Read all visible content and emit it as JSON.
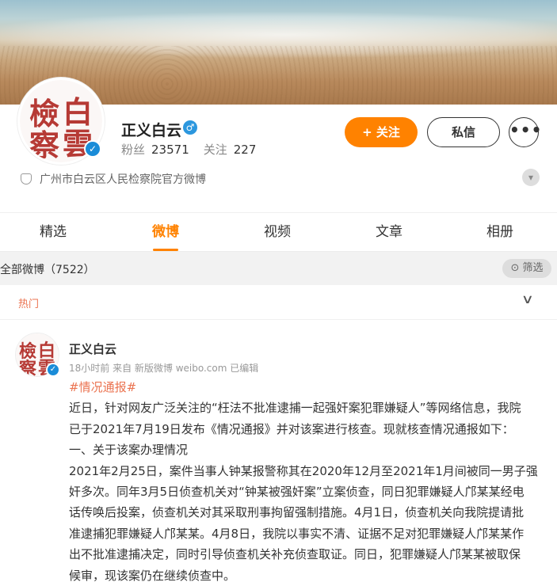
{
  "profile": {
    "name": "正义白云",
    "fans_label": "粉丝",
    "fans_count": "23571",
    "follow_label": "关注",
    "follow_count": "227",
    "description": "广州市白云区人民检察院官方微博",
    "follow_button": "+ 关注",
    "message_button": "私信",
    "more_button": "•••",
    "avatar_seal_chars": [
      "白",
      "雲",
      "檢",
      "察"
    ]
  },
  "tabs": [
    "精选",
    "微博",
    "视频",
    "文章",
    "相册"
  ],
  "active_tab": "微博",
  "feed": {
    "all_label": "全部微博（7522）",
    "filter_label": "筛选",
    "hot_label": "热门"
  },
  "post": {
    "author": "正义白云",
    "meta": "18小时前 来自 新版微博 weibo.com 已编辑",
    "tag": "#情况通报#",
    "body_lines": [
      "近日，针对网友广泛关注的“枉法不批准逮捕一起强奸案犯罪嫌疑人”等网络信息，我院",
      "已于2021年7月19日发布《情况通报》并对该案进行核查。现就核查情况通报如下：",
      "一、关于该案办理情况",
      "2021年2月25日，案件当事人钟某报警称其在2020年12月至2021年1月间被同一男子强",
      "奸多次。同年3月5日侦查机关对“钟某被强奸案”立案侦查，同日犯罪嫌疑人邝某某经电",
      "话传唤后投案，侦查机关对其采取刑事拘留强制措施。4月1日，侦查机关向我院提请批",
      "准逮捕犯罪嫌疑人邝某某。4月8日，我院以事实不清、证据不足对犯罪嫌疑人邝某某作",
      "出不批准逮捕决定，同时引导侦查机关补充侦查取证。同日，犯罪嫌疑人邝某某被取保",
      "候审，现该案仍在继续侦查中。"
    ]
  },
  "colors": {
    "accent": "#ff8200",
    "tag": "#eb7350",
    "verified": "#1a8cd8",
    "seal": "#b63a35"
  },
  "icons": [
    "verified-badge-icon",
    "male-icon",
    "shield-icon",
    "chevron-down-icon",
    "filter-icon",
    "more-icon"
  ]
}
